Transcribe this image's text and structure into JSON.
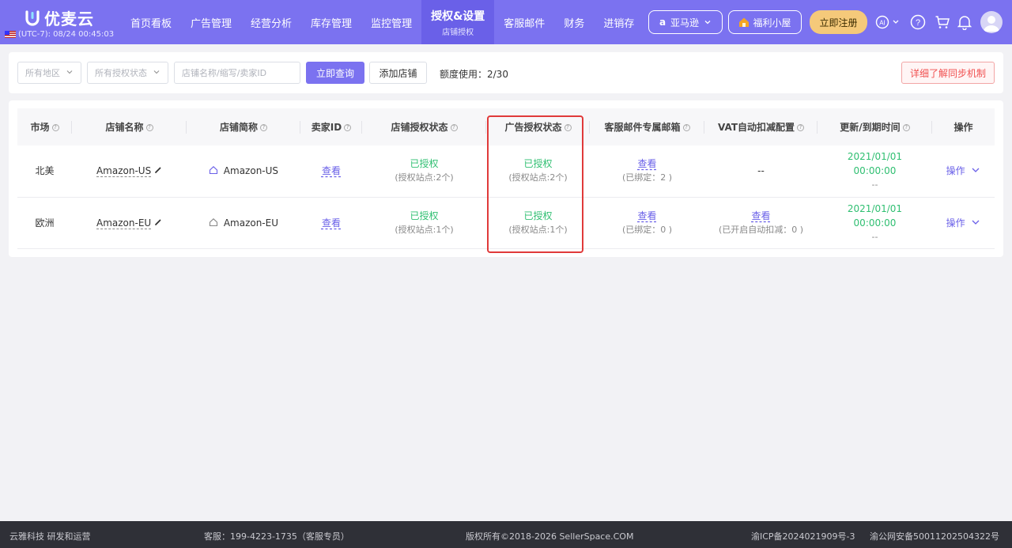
{
  "brand": {
    "name": "优麦云",
    "clock": "(UTC-7): 08/24 00:45:03"
  },
  "nav": [
    {
      "label": "首页看板",
      "sub": ""
    },
    {
      "label": "广告管理",
      "sub": ""
    },
    {
      "label": "经营分析",
      "sub": ""
    },
    {
      "label": "库存管理",
      "sub": ""
    },
    {
      "label": "监控管理",
      "sub": ""
    },
    {
      "label": "授权&设置",
      "sub": "店铺授权"
    },
    {
      "label": "客服邮件",
      "sub": ""
    },
    {
      "label": "财务",
      "sub": ""
    },
    {
      "label": "进销存",
      "sub": ""
    }
  ],
  "header_actions": {
    "platform": "亚马逊",
    "welfare": "福利小屋",
    "register": "立即注册"
  },
  "filters": {
    "region_placeholder": "所有地区",
    "auth_placeholder": "所有授权状态",
    "search_placeholder": "店铺名称/缩写/卖家ID",
    "query_label": "立即查询",
    "add_label": "添加店铺",
    "quota": "额度使用：2/30",
    "sync_label": "详细了解同步机制"
  },
  "table": {
    "headers": [
      "市场",
      "店铺名称",
      "店铺简称",
      "卖家ID",
      "店铺授权状态",
      "广告授权状态",
      "客服邮件专属邮箱",
      "VAT自动扣减配置",
      "更新/到期时间",
      "操作"
    ],
    "rows": [
      {
        "market": "北美",
        "store_name": "Amazon-US",
        "short_name": "Amazon-US",
        "seller_id": "查看",
        "store_auth": "已授权",
        "store_auth_sub": "(授权站点:2个)",
        "ad_auth": "已授权",
        "ad_auth_sub": "(授权站点:2个)",
        "mail": "查看",
        "mail_sub": "(已绑定：2 )",
        "vat": "--",
        "vat_sub": "",
        "update": "2021/01/01",
        "update_time": "00:00:00",
        "expire": "--",
        "action": "操作"
      },
      {
        "market": "欧洲",
        "store_name": "Amazon-EU",
        "short_name": "Amazon-EU",
        "seller_id": "查看",
        "store_auth": "已授权",
        "store_auth_sub": "(授权站点:1个)",
        "ad_auth": "已授权",
        "ad_auth_sub": "(授权站点:1个)",
        "mail": "查看",
        "mail_sub": "(已绑定：0 )",
        "vat": "查看",
        "vat_sub": "(已开启自动扣减：0 )",
        "update": "2021/01/01",
        "update_time": "00:00:00",
        "expire": "--",
        "action": "操作"
      }
    ]
  },
  "footer": {
    "company": "云雅科技 研发和运营",
    "service": "客服：199-4223-1735（客服专员）",
    "copyright": "版权所有©2018-2026 SellerSpace.COM",
    "icp": "渝ICP备2024021909号-3",
    "security": "渝公网安备50011202504322号"
  },
  "colors": {
    "primary": "#7b72f0",
    "success": "#2fbf71",
    "danger": "#e03a3a"
  }
}
